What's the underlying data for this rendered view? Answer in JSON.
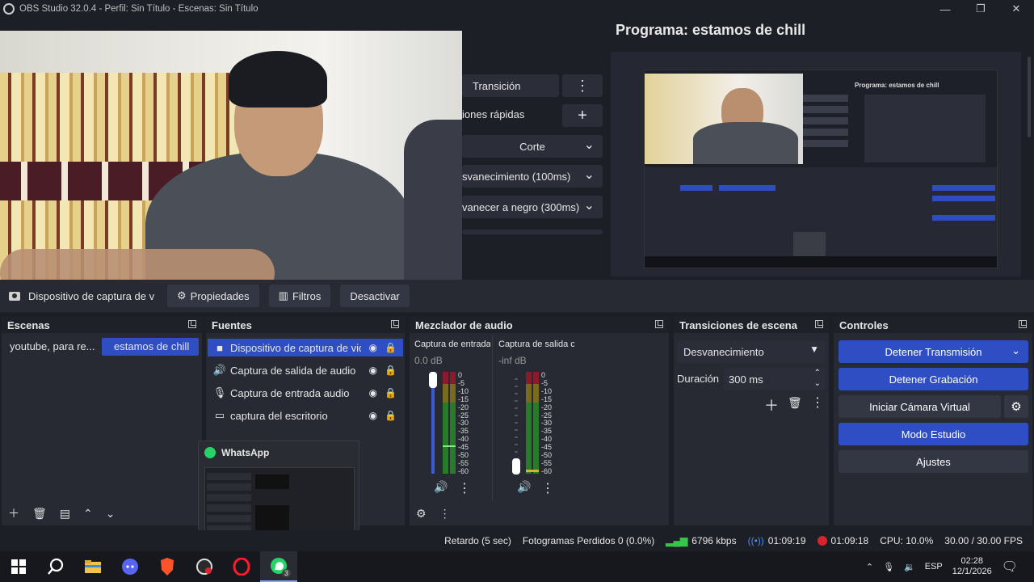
{
  "window": {
    "title": "OBS Studio 32.0.4 - Perfil: Sin Título - Escenas: Sin Título"
  },
  "transition_panel": {
    "transition_label": "Transición",
    "quick_label": "iones rápidas",
    "cut_label": "Corte",
    "fade100_label": "svanecimiento (100ms)",
    "fade_black_label": "vanecer a negro (300ms)"
  },
  "program": {
    "title": "Programa: estamos de chill",
    "mini_title": "Programa: estamos de chill"
  },
  "source_toolbar": {
    "source_name": "Dispositivo de captura de v",
    "properties_label": "Propiedades",
    "filters_label": "Filtros",
    "deactivate_label": "Desactivar"
  },
  "scenes": {
    "header": "Escenas",
    "items": [
      {
        "label": "youtube, para re..."
      },
      {
        "label": "estamos de chill"
      }
    ]
  },
  "sources": {
    "header": "Fuentes",
    "items": [
      {
        "label": "Dispositivo de captura de vid"
      },
      {
        "label": "Captura de salida de audio"
      },
      {
        "label": "Captura de entrada audio"
      },
      {
        "label": "captura del escritorio"
      }
    ]
  },
  "mixer": {
    "header": "Mezclador de audio",
    "channels": [
      {
        "name": "Captura de entrada",
        "db": "0.0 dB"
      },
      {
        "name": "Captura de salida c",
        "db": "-inf dB"
      }
    ],
    "scale": [
      "0",
      "-5",
      "-10",
      "-15",
      "-20",
      "-25",
      "-30",
      "-35",
      "-40",
      "-45",
      "-50",
      "-55",
      "-60"
    ]
  },
  "transitions": {
    "header": "Transiciones de escena",
    "selected": "Desvanecimiento",
    "duration_label": "Duración",
    "duration_value": "300 ms"
  },
  "controls": {
    "header": "Controles",
    "stop_stream": "Detener Transmisión",
    "stop_recording": "Detener Grabación",
    "virtual_cam": "Iniciar Cámara Virtual",
    "studio_mode": "Modo Estudio",
    "settings": "Ajustes"
  },
  "whatsapp_preview": {
    "title": "WhatsApp"
  },
  "status": {
    "delay": "Retardo (5 sec)",
    "dropped": "Fotogramas Perdidos 0 (0.0%)",
    "bitrate": "6796 kbps",
    "stream_time": "01:09:19",
    "rec_time": "01:09:18",
    "cpu": "CPU: 10.0%",
    "fps": "30.00 / 30.00 FPS"
  },
  "taskbar": {
    "whatsapp_badge": "3",
    "lang": "ESP",
    "time": "02:28",
    "date": "12/1/2026"
  },
  "colors": {
    "accent_blue": "#2f4ec3",
    "panel": "#272a33",
    "background": "#1d1f26",
    "rec_red": "#d8232f",
    "signal_green": "#37c64a"
  }
}
